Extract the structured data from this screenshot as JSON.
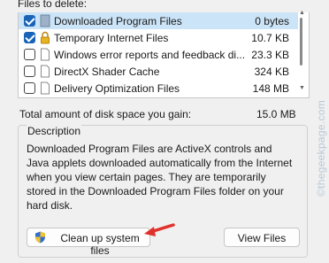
{
  "files_label": "Files to delete:",
  "files": [
    {
      "name": "Downloaded Program Files",
      "size": "0 bytes",
      "checked": true,
      "selected": true,
      "icon": "folder-icon"
    },
    {
      "name": "Temporary Internet Files",
      "size": "10.7 KB",
      "checked": true,
      "selected": false,
      "icon": "lock-icon"
    },
    {
      "name": "Windows error reports and feedback di...",
      "size": "23.3 KB",
      "checked": false,
      "selected": false,
      "icon": "document-icon"
    },
    {
      "name": "DirectX Shader Cache",
      "size": "324 KB",
      "checked": false,
      "selected": false,
      "icon": "document-icon"
    },
    {
      "name": "Delivery Optimization Files",
      "size": "148 MB",
      "checked": false,
      "selected": false,
      "icon": "document-icon"
    }
  ],
  "total_label": "Total amount of disk space you gain:",
  "total_value": "15.0 MB",
  "description": {
    "legend": "Description",
    "text": "Downloaded Program Files are ActiveX controls and Java applets downloaded automatically from the Internet when you view certain pages. They are temporarily stored in the Downloaded Program Files folder on your hard disk."
  },
  "buttons": {
    "cleanup_label": "Clean up system files",
    "view_files_label": "View Files"
  },
  "watermark": "©thegeekpage.com",
  "colors": {
    "accent": "#1a64b8",
    "selection": "#cce4f7",
    "arrow": "#e0312c"
  }
}
